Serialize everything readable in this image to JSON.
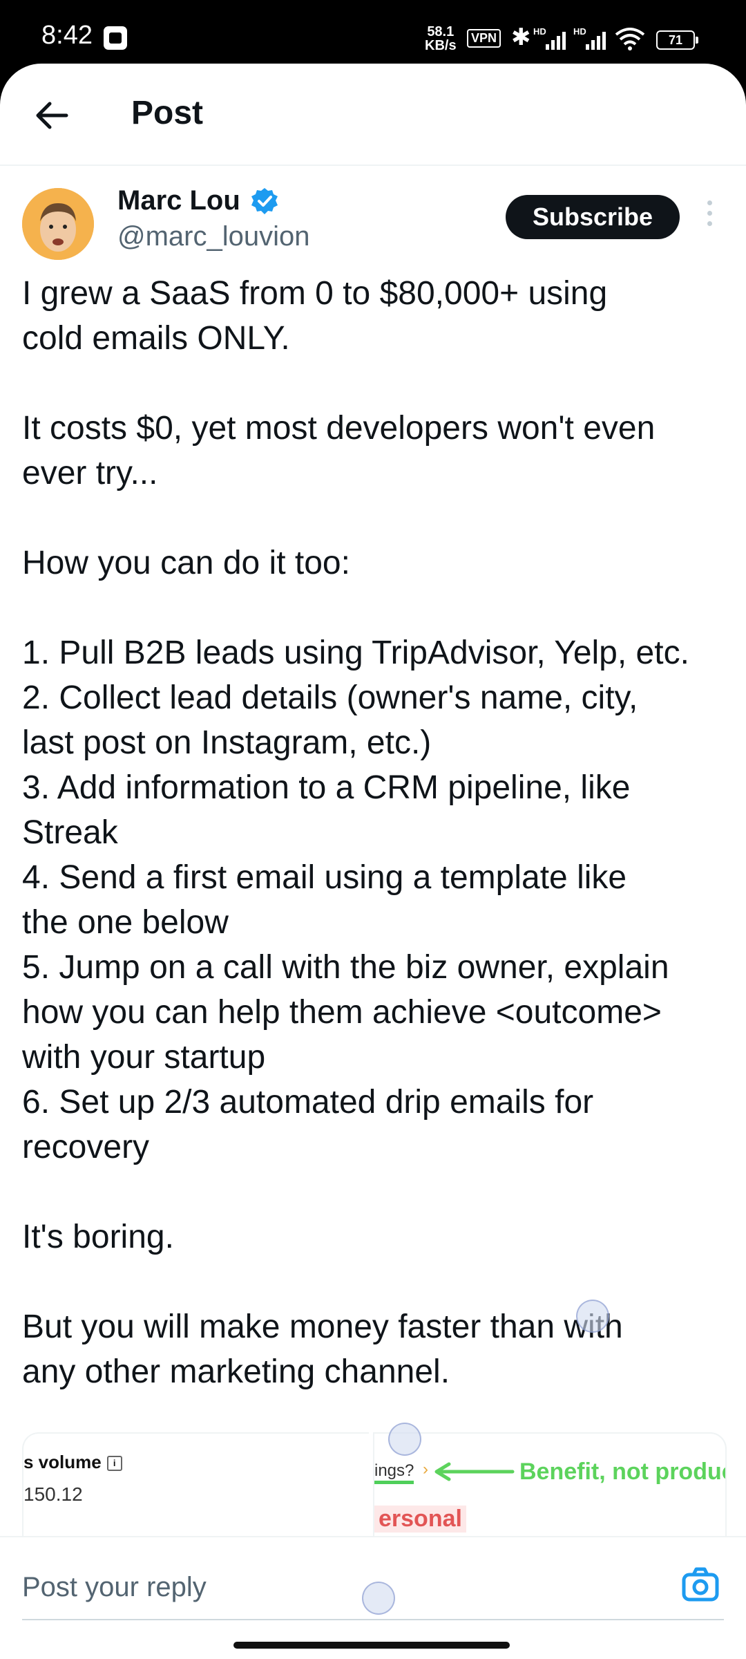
{
  "status_bar": {
    "time": "8:42",
    "net_speed_value": "58.1",
    "net_speed_unit": "KB/s",
    "vpn": "VPN",
    "battery": "71",
    "signal_label": "HD"
  },
  "header": {
    "title": "Post"
  },
  "author": {
    "name": "Marc Lou",
    "handle": "@marc_louvion",
    "subscribe_label": "Subscribe"
  },
  "post": {
    "text": "I grew a SaaS from 0 to $80,000+ using\ncold emails ONLY.\n\nIt costs $0, yet most developers won't even\never try...\n\nHow you can do it too:\n\n1. Pull B2B leads using TripAdvisor, Yelp, etc.\n2. Collect lead details (owner's name, city,\nlast post on Instagram, etc.)\n3. Add information to a CRM pipeline, like\nStreak\n4. Send a first email using a template like\nthe one below\n5. Jump on a call with the biz owner, explain\nhow you can help them achieve <outcome>\nwith your startup\n6. Set up 2/3 automated drip emails for\nrecovery\n\nIt's boring.\n\nBut you will make money faster than with\nany other marketing channel."
  },
  "media": [
    {
      "title": "s volume",
      "value": "150.12"
    },
    {
      "line1": "ings?",
      "callout": "Benefit, not produc",
      "highlight": "ersonal"
    }
  ],
  "reply": {
    "placeholder": "Post your reply"
  },
  "colors": {
    "accent": "#1d9bf0",
    "text": "#0f1419",
    "muted": "#536471",
    "green": "#5cd35c",
    "red": "#e25555"
  },
  "icons": [
    "back-arrow-icon",
    "verified-badge-icon",
    "more-options-icon",
    "camera-icon",
    "bluetooth-icon",
    "wifi-icon",
    "battery-icon"
  ]
}
